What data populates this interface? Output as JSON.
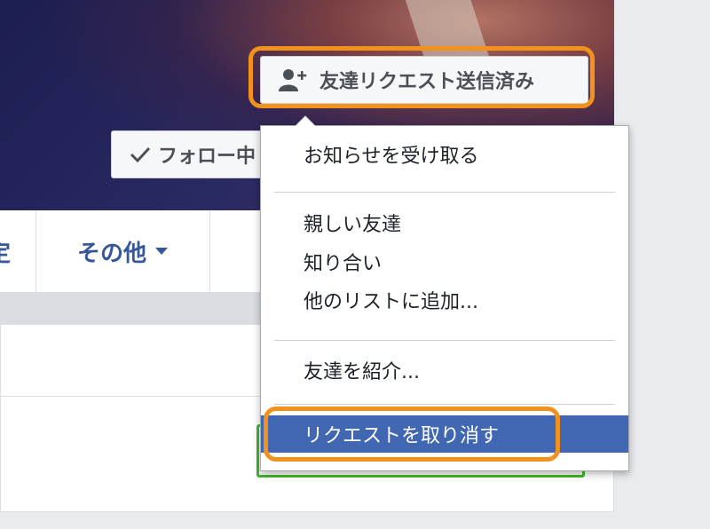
{
  "profile": {
    "friend_request_sent_label": "友達リクエスト送信済み",
    "follow_label": "フォロー中"
  },
  "tabs": {
    "left_partial": "定",
    "more_label": "その他"
  },
  "menu": {
    "get_notifications": "お知らせを受け取る",
    "close_friends": "親しい友達",
    "acquaintances": "知り合い",
    "add_to_list": "他のリストに追加...",
    "suggest_friends": "友達を紹介...",
    "cancel_request": "リクエストを取り消す"
  },
  "colors": {
    "highlight": "#f2911b",
    "menu_active": "#4267b2",
    "link": "#365899",
    "accept_green": "#42b72a"
  }
}
